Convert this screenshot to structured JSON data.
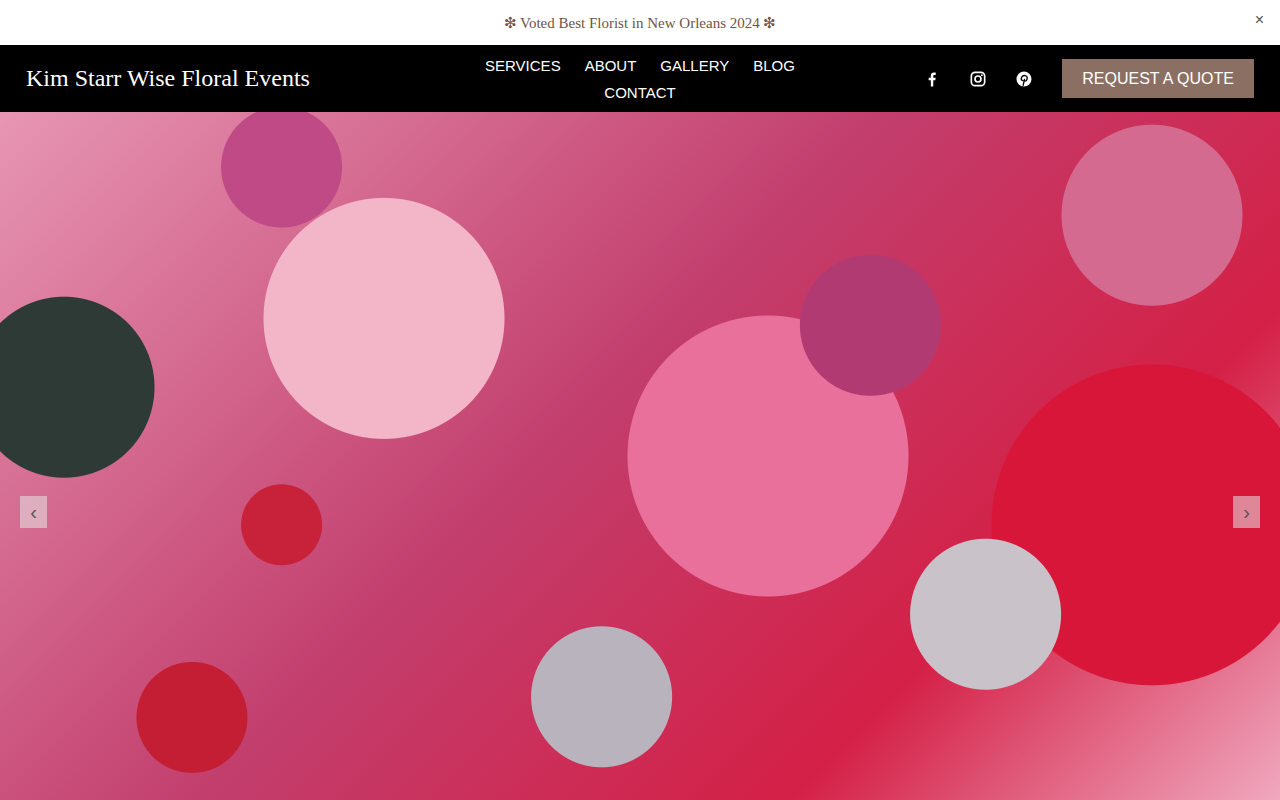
{
  "announcement": {
    "text": "❇ Voted Best Florist in New Orleans 2024 ❇",
    "close": "×"
  },
  "header": {
    "logo": "Kim Starr Wise Floral Events",
    "nav": [
      {
        "label": "SERVICES"
      },
      {
        "label": "ABOUT"
      },
      {
        "label": "GALLERY"
      },
      {
        "label": "BLOG"
      },
      {
        "label": "CONTACT"
      }
    ],
    "cta": "REQUEST A QUOTE"
  },
  "hero": {
    "prev": "‹",
    "next": "›"
  }
}
